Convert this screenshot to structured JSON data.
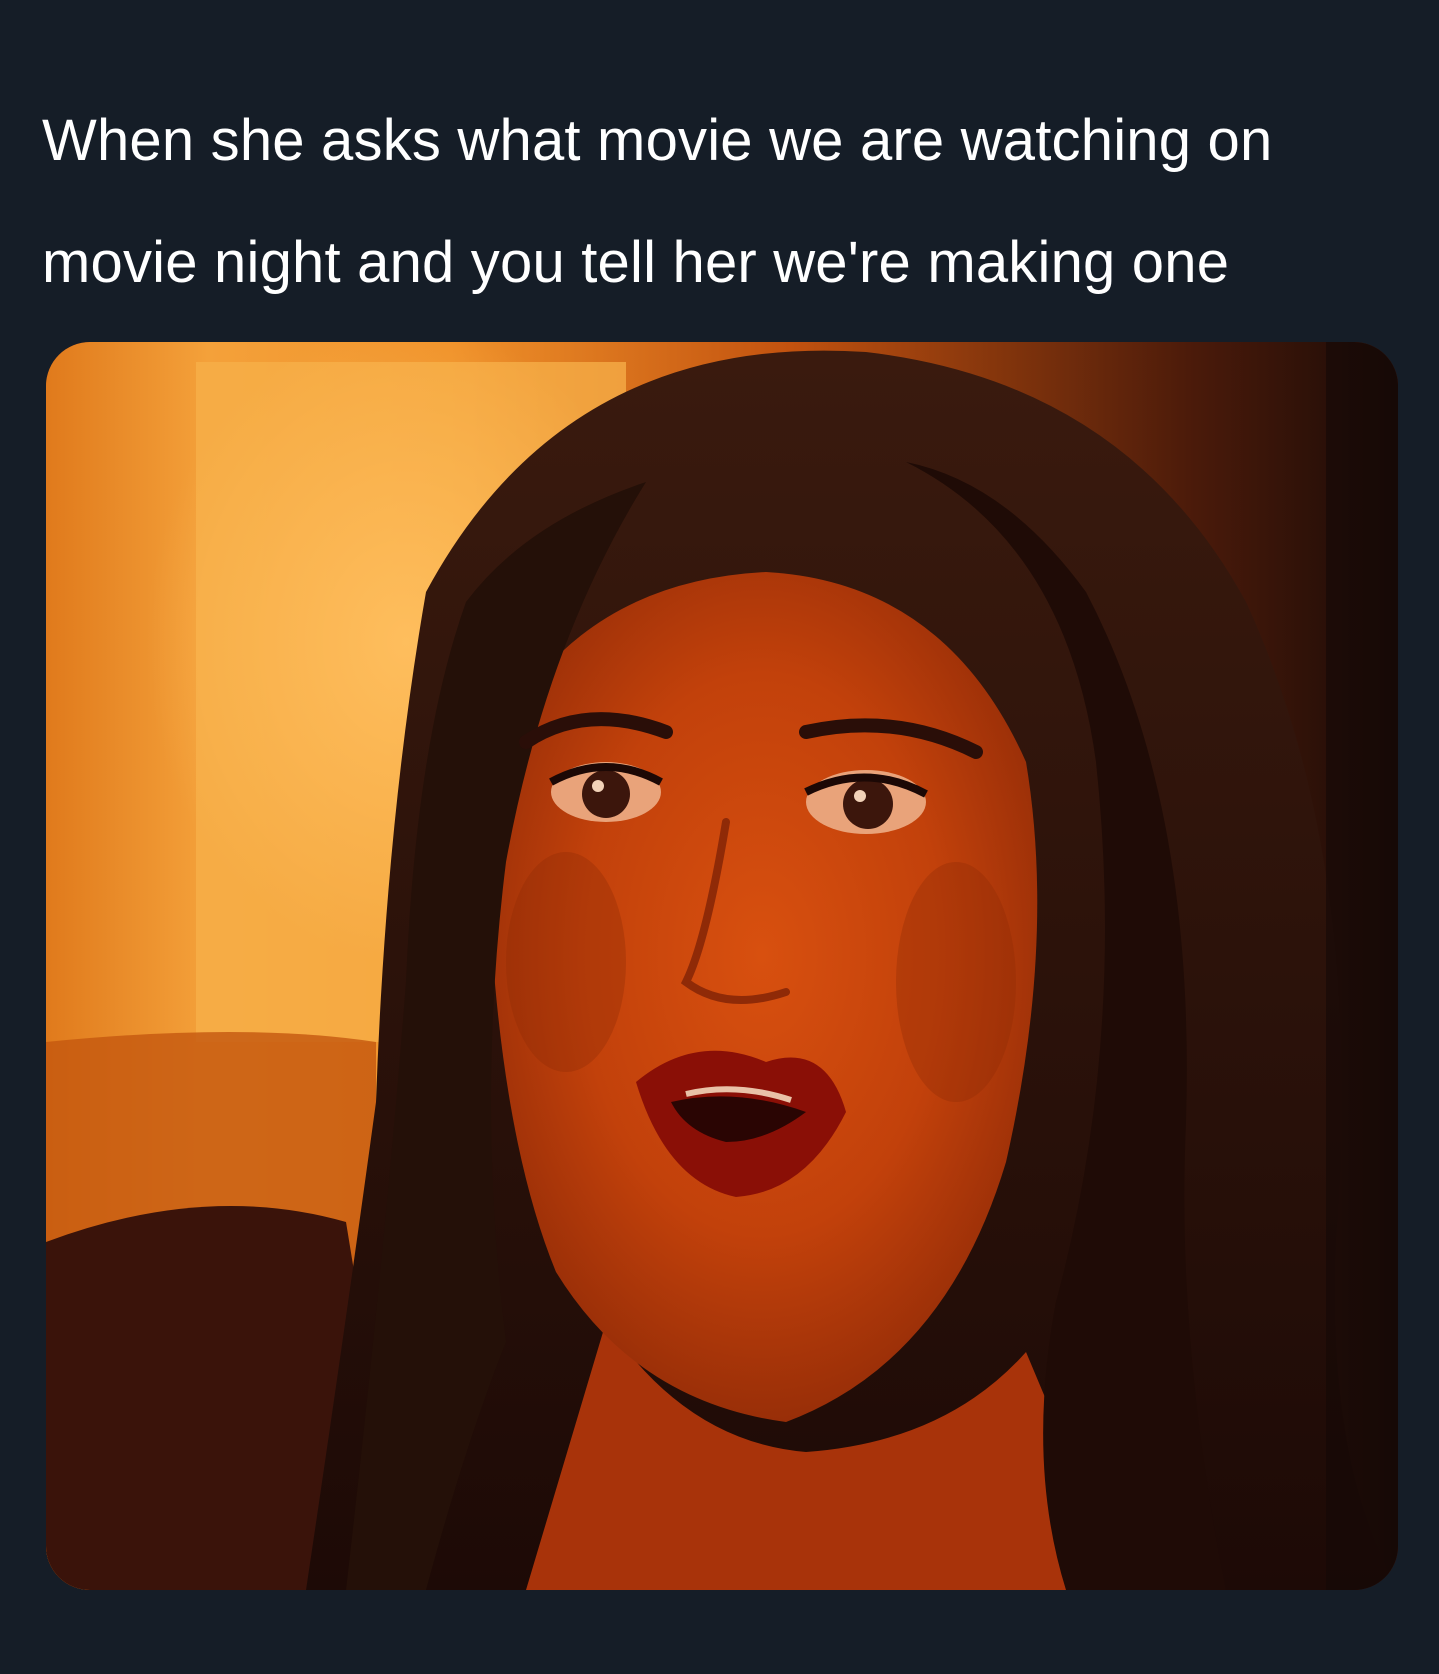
{
  "tweet": {
    "text": "When she asks what movie we are watching on movie night and you tell her we're making one"
  },
  "media": {
    "kind": "photo",
    "subject": "woman-with-long-dark-hair-surprised-expression",
    "colors": {
      "background": "#151d27",
      "text": "#ffffff",
      "warm_light": "#f7a43a",
      "skin_shadow": "#b83a0c",
      "hair": "#2a0f08",
      "lips": "#8a0f06"
    }
  }
}
